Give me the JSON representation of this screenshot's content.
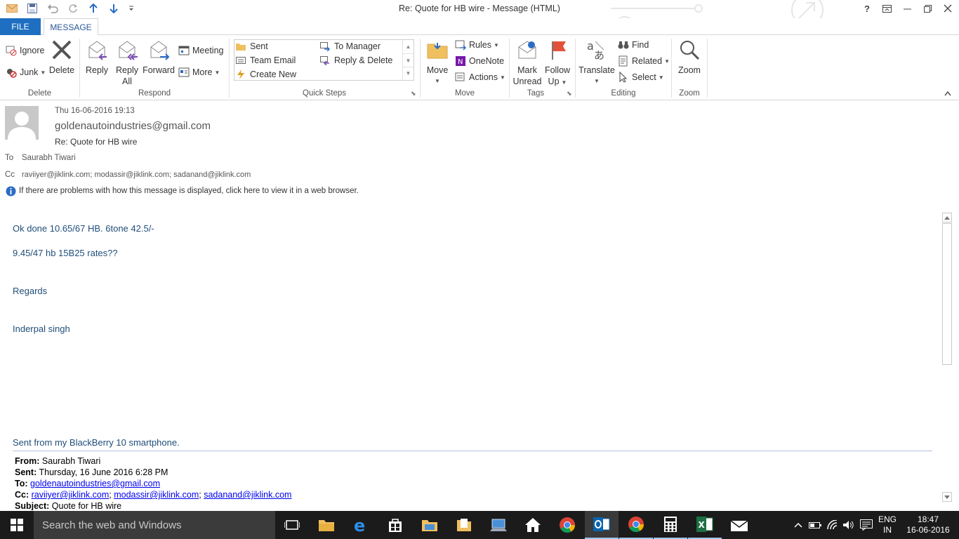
{
  "window": {
    "title": "Re: Quote for HB wire - Message (HTML)",
    "help": "?"
  },
  "tabs": {
    "file": "FILE",
    "message": "MESSAGE"
  },
  "ribbon": {
    "delete_group": {
      "label": "Delete",
      "ignore": "Ignore",
      "junk": "Junk",
      "delete": "Delete"
    },
    "respond_group": {
      "label": "Respond",
      "reply": "Reply",
      "reply_all_1": "Reply",
      "reply_all_2": "All",
      "forward": "Forward",
      "meeting": "Meeting",
      "more": "More"
    },
    "quicksteps_group": {
      "label": "Quick Steps",
      "items": [
        "Sent",
        "To Manager",
        "Team Email",
        "Reply & Delete",
        "Create New"
      ]
    },
    "move_group": {
      "label": "Move",
      "move": "Move",
      "rules": "Rules",
      "onenote": "OneNote",
      "actions": "Actions"
    },
    "tags_group": {
      "label": "Tags",
      "mark_unread_1": "Mark",
      "mark_unread_2": "Unread",
      "follow_up_1": "Follow",
      "follow_up_2": "Up"
    },
    "editing_group": {
      "label": "Editing",
      "translate": "Translate",
      "find": "Find",
      "related": "Related",
      "select": "Select"
    },
    "zoom_group": {
      "label": "Zoom",
      "zoom": "Zoom"
    }
  },
  "message": {
    "datetime": "Thu 16-06-2016 19:13",
    "from": "goldenautoindustries@gmail.com",
    "subject": "Re: Quote for HB wire",
    "to_label": "To",
    "to": "Saurabh Tiwari",
    "cc_label": "Cc",
    "cc": "raviiyer@jiklink.com; modassir@jiklink.com; sadanand@jiklink.com",
    "info_bar": "If there are problems with how this message is displayed, click here to view it in a web browser.",
    "body_lines": [
      "Ok done 10.65/67 HB. 6tone  42.5/-",
      "9.45/47 hb 15B25 rates??",
      "Regards",
      "Inderpal singh"
    ],
    "signature": "Sent from my BlackBerry 10 smartphone.",
    "forwarded": {
      "from_label": "From:",
      "from": "Saurabh Tiwari",
      "sent_label": "Sent:",
      "sent": "Thursday, 16 June 2016 6:28 PM",
      "to_label": "To:",
      "to": "goldenautoindustries@gmail.com",
      "cc_label": "Cc:",
      "cc": [
        "raviiyer@jiklink.com",
        "modassir@jiklink.com",
        "sadanand@jiklink.com"
      ],
      "subject_label": "Subject:",
      "subject": "Quote for HB wire"
    }
  },
  "taskbar": {
    "search_placeholder": "Search the web and Windows",
    "lang_1": "ENG",
    "lang_2": "IN",
    "time": "18:47",
    "date": "16-06-2016"
  },
  "colors": {
    "accent": "#1e6fc1",
    "body_text": "#1f4e79",
    "taskbar": "#1b1b1b"
  }
}
